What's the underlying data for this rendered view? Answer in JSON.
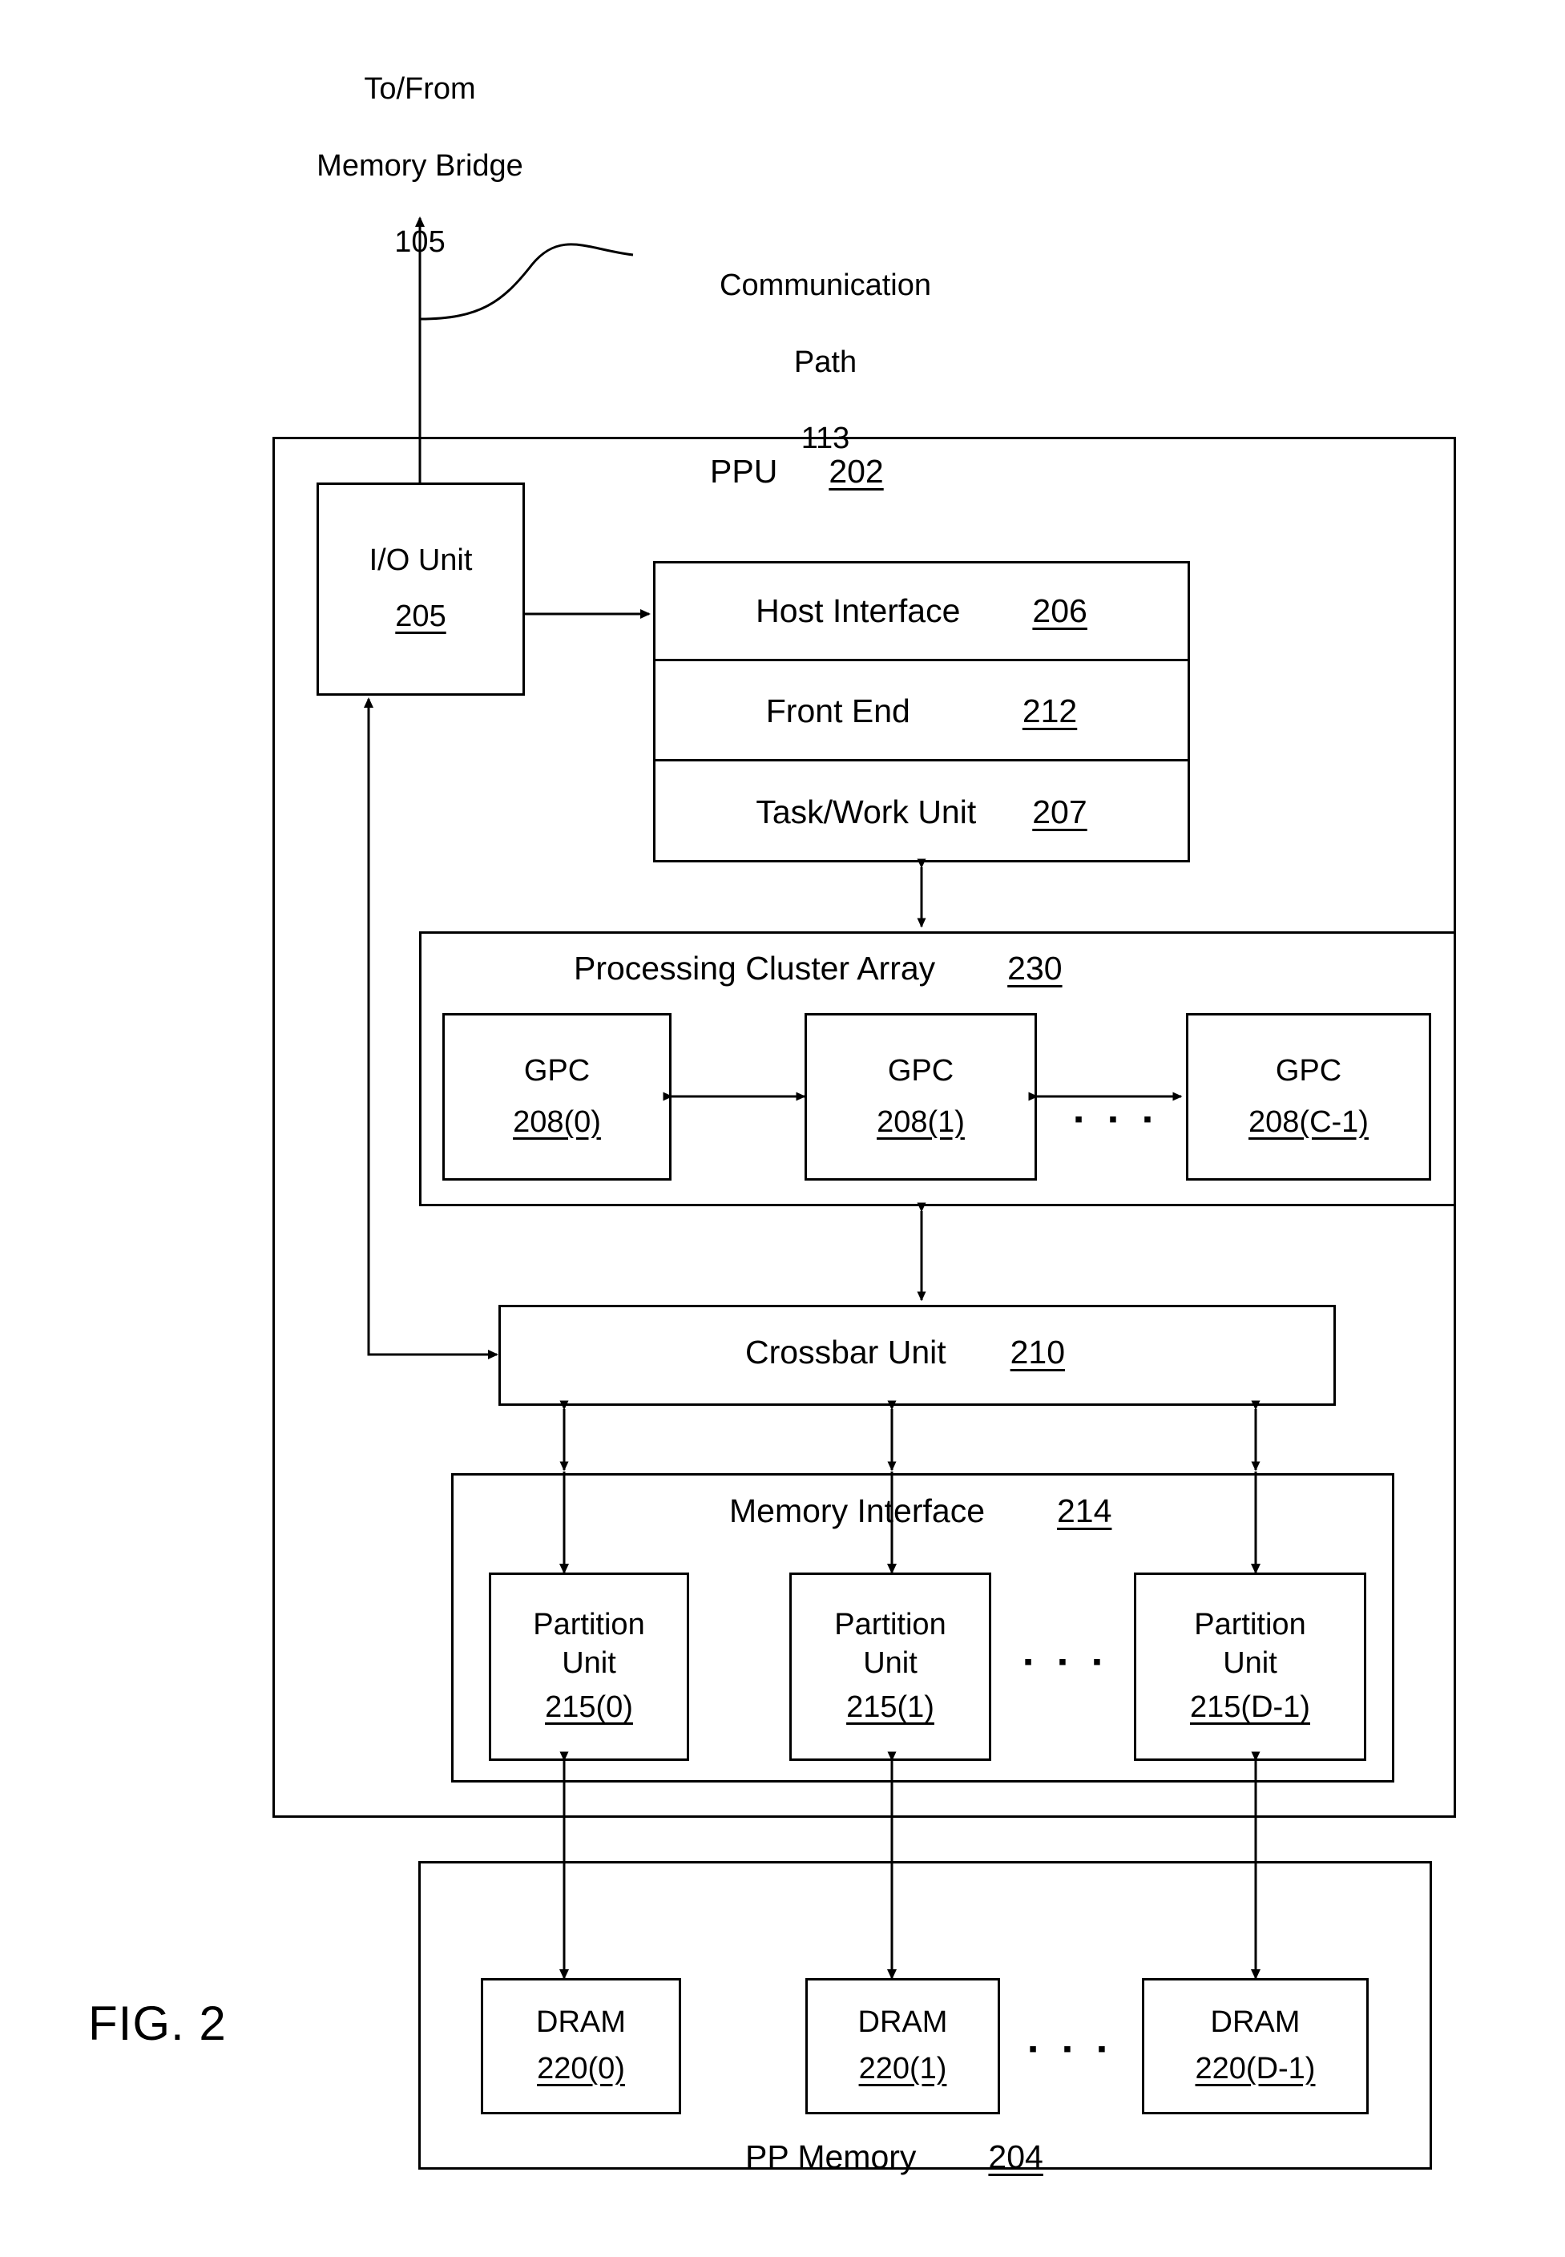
{
  "figure": {
    "label": "FIG. 2",
    "top_annotation": {
      "line1": "To/From",
      "line2": "Memory Bridge",
      "ref": "105"
    },
    "comm_path": {
      "line1": "Communication",
      "line2": "Path",
      "ref": "113"
    }
  },
  "ppu": {
    "title": "PPU",
    "ref": "202",
    "io_unit": {
      "title": "I/O Unit",
      "ref": "205"
    },
    "interface_stack": [
      {
        "title": "Host Interface",
        "ref": "206"
      },
      {
        "title": "Front End",
        "ref": "212"
      },
      {
        "title": "Task/Work Unit",
        "ref": "207"
      }
    ],
    "processing_cluster_array": {
      "title": "Processing Cluster Array",
      "ref": "230",
      "gpcs": [
        {
          "title": "GPC",
          "ref": "208(0)"
        },
        {
          "title": "GPC",
          "ref": "208(1)"
        },
        {
          "title": "GPC",
          "ref": "208(C-1)"
        }
      ],
      "ellipsis": "▪ ▪ ▪"
    },
    "crossbar_unit": {
      "title": "Crossbar Unit",
      "ref": "210"
    },
    "memory_interface": {
      "title": "Memory Interface",
      "ref": "214",
      "partition_units": [
        {
          "line1": "Partition",
          "line2": "Unit",
          "ref": "215(0)"
        },
        {
          "line1": "Partition",
          "line2": "Unit",
          "ref": "215(1)"
        },
        {
          "line1": "Partition",
          "line2": "Unit",
          "ref": "215(D-1)"
        }
      ],
      "ellipsis": "▪ ▪ ▪"
    }
  },
  "pp_memory": {
    "title": "PP Memory",
    "ref": "204",
    "drams": [
      {
        "title": "DRAM",
        "ref": "220(0)"
      },
      {
        "title": "DRAM",
        "ref": "220(1)"
      },
      {
        "title": "DRAM",
        "ref": "220(D-1)"
      }
    ],
    "ellipsis": "▪ ▪ ▪"
  }
}
